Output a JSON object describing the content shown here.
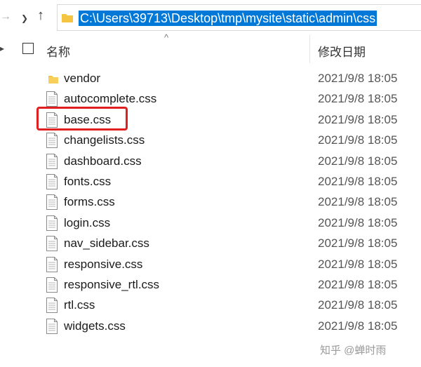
{
  "window": {
    "address_path": "C:\\Users\\39713\\Desktop\\tmp\\mysite\\static\\admin\\css",
    "forward_icon": "arrow-right-icon",
    "history_icon": "chevron-down-icon",
    "up_icon": "arrow-up-icon"
  },
  "columns": {
    "name_label": "名称",
    "date_label": "修改日期"
  },
  "files": [
    {
      "name": "vendor",
      "type": "folder",
      "modified": "2021/9/8 18:05"
    },
    {
      "name": "autocomplete.css",
      "type": "file",
      "modified": "2021/9/8 18:05"
    },
    {
      "name": "base.css",
      "type": "file",
      "modified": "2021/9/8 18:05",
      "highlighted": true
    },
    {
      "name": "changelists.css",
      "type": "file",
      "modified": "2021/9/8 18:05"
    },
    {
      "name": "dashboard.css",
      "type": "file",
      "modified": "2021/9/8 18:05"
    },
    {
      "name": "fonts.css",
      "type": "file",
      "modified": "2021/9/8 18:05"
    },
    {
      "name": "forms.css",
      "type": "file",
      "modified": "2021/9/8 18:05"
    },
    {
      "name": "login.css",
      "type": "file",
      "modified": "2021/9/8 18:05"
    },
    {
      "name": "nav_sidebar.css",
      "type": "file",
      "modified": "2021/9/8 18:05"
    },
    {
      "name": "responsive.css",
      "type": "file",
      "modified": "2021/9/8 18:05"
    },
    {
      "name": "responsive_rtl.css",
      "type": "file",
      "modified": "2021/9/8 18:05"
    },
    {
      "name": "rtl.css",
      "type": "file",
      "modified": "2021/9/8 18:05"
    },
    {
      "name": "widgets.css",
      "type": "file",
      "modified": "2021/9/8 18:05"
    }
  ],
  "watermark": "知乎 @蝉时雨",
  "colors": {
    "selection": "#0078d7",
    "highlight_box": "#e02020",
    "folder": "#f4c542"
  }
}
